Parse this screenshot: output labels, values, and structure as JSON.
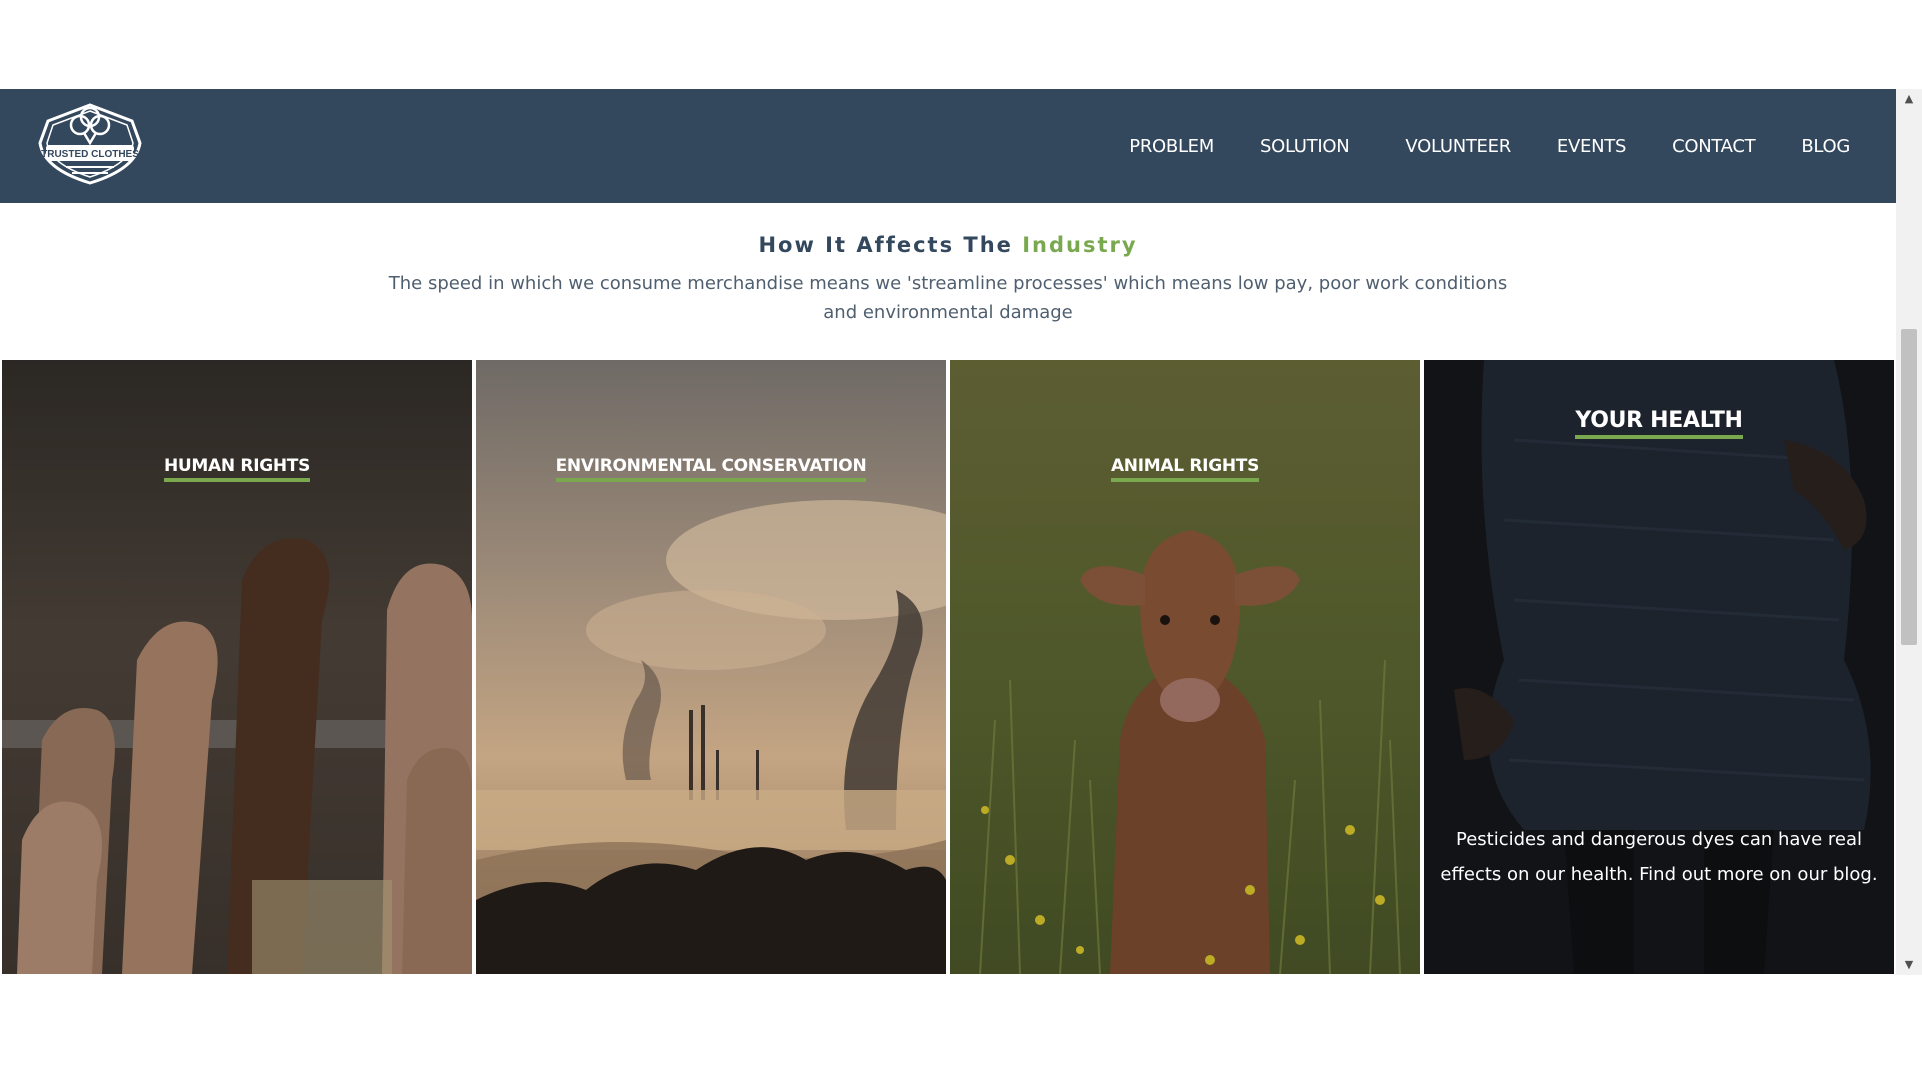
{
  "nav": {
    "logo_text": "TRUSTED CLOTHES",
    "items": [
      {
        "label": "PROBLEM"
      },
      {
        "label": "SOLUTION"
      },
      {
        "label": "VOLUNTEER"
      },
      {
        "label": "EVENTS"
      },
      {
        "label": "CONTACT"
      },
      {
        "label": "BLOG"
      }
    ]
  },
  "intro": {
    "title_main": "How It Affects The ",
    "title_accent": "Industry",
    "description": "The speed in which we consume merchandise means we 'streamline processes' which means low pay, poor work conditions and environmental damage"
  },
  "panels": [
    {
      "title": "HUMAN RIGHTS"
    },
    {
      "title": "ENVIRONMENTAL CONSERVATION"
    },
    {
      "title": "ANIMAL RIGHTS"
    },
    {
      "title": "YOUR HEALTH",
      "text": "Pesticides and dangerous dyes can have real effects on our health. Find out more on our blog."
    }
  ],
  "colors": {
    "navbar": "#33475d",
    "accent": "#7aa84f",
    "heading": "#33475d"
  },
  "icons": {
    "logo": "cotton-boll-logo-icon",
    "scroll_up": "scroll-up-arrow-icon",
    "scroll_down": "scroll-down-arrow-icon"
  }
}
